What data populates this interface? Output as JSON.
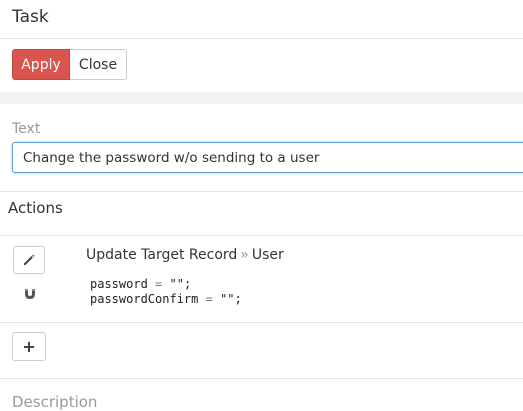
{
  "header": {
    "title": "Task"
  },
  "toolbar": {
    "apply_label": "Apply",
    "close_label": "Close"
  },
  "text_field": {
    "label": "Text",
    "value": "Change the password w/o sending to a user"
  },
  "actions": {
    "heading": "Actions",
    "items": [
      {
        "type": "Update Target Record",
        "separator": "»",
        "target": "User",
        "code": [
          {
            "field": "password",
            "op": "=",
            "value": "\"\"",
            "end": ";"
          },
          {
            "field": "passwordConfirm",
            "op": "=",
            "value": "\"\"",
            "end": ";"
          }
        ],
        "icons": [
          "pencil-icon",
          "magnet-icon"
        ]
      }
    ],
    "add_icon": "plus-icon"
  },
  "next_section": {
    "label": "Description"
  },
  "colors": {
    "accent": "#d9534f",
    "focus": "#5b9dd9"
  }
}
